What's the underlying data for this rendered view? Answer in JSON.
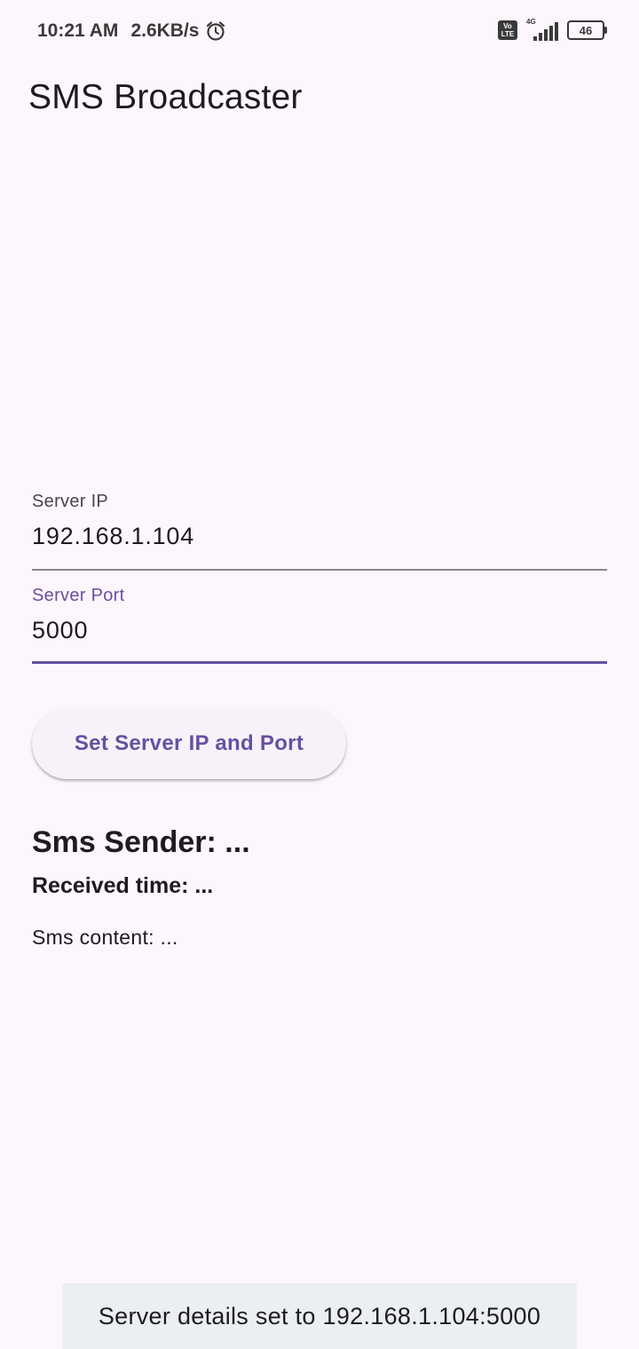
{
  "status_bar": {
    "time": "10:21 AM",
    "net_speed": "2.6KB/s",
    "volte_top": "Vo",
    "volte_bottom": "LTE",
    "network_type": "4G",
    "battery_level": "46",
    "icons": [
      "alarm-icon",
      "volte-icon",
      "signal-icon",
      "battery-icon"
    ]
  },
  "app_bar": {
    "title": "SMS Broadcaster"
  },
  "form": {
    "server_ip": {
      "label": "Server IP",
      "value": "192.168.1.104"
    },
    "server_port": {
      "label": "Server Port",
      "value": "5000"
    },
    "submit_label": "Set Server IP and Port"
  },
  "sms": {
    "sender": "Sms Sender: ...",
    "received_time": "Received time: ...",
    "content": "Sms content: ..."
  },
  "snackbar": {
    "message": "Server details set to 192.168.1.104:5000"
  },
  "colors": {
    "background": "#fdf6fd",
    "accent": "#6750a4",
    "snackbar_bg": "#eceff1",
    "text": "#1d1b20"
  }
}
